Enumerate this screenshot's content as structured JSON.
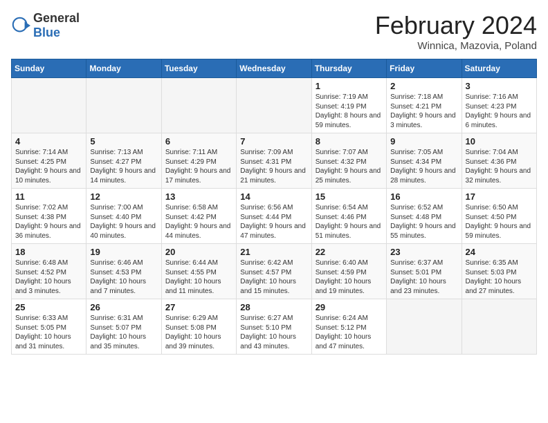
{
  "logo": {
    "general": "General",
    "blue": "Blue"
  },
  "header": {
    "title": "February 2024",
    "subtitle": "Winnica, Mazovia, Poland"
  },
  "weekdays": [
    "Sunday",
    "Monday",
    "Tuesday",
    "Wednesday",
    "Thursday",
    "Friday",
    "Saturday"
  ],
  "weeks": [
    [
      {
        "day": "",
        "info": ""
      },
      {
        "day": "",
        "info": ""
      },
      {
        "day": "",
        "info": ""
      },
      {
        "day": "",
        "info": ""
      },
      {
        "day": "1",
        "info": "Sunrise: 7:19 AM\nSunset: 4:19 PM\nDaylight: 8 hours and 59 minutes."
      },
      {
        "day": "2",
        "info": "Sunrise: 7:18 AM\nSunset: 4:21 PM\nDaylight: 9 hours and 3 minutes."
      },
      {
        "day": "3",
        "info": "Sunrise: 7:16 AM\nSunset: 4:23 PM\nDaylight: 9 hours and 6 minutes."
      }
    ],
    [
      {
        "day": "4",
        "info": "Sunrise: 7:14 AM\nSunset: 4:25 PM\nDaylight: 9 hours and 10 minutes."
      },
      {
        "day": "5",
        "info": "Sunrise: 7:13 AM\nSunset: 4:27 PM\nDaylight: 9 hours and 14 minutes."
      },
      {
        "day": "6",
        "info": "Sunrise: 7:11 AM\nSunset: 4:29 PM\nDaylight: 9 hours and 17 minutes."
      },
      {
        "day": "7",
        "info": "Sunrise: 7:09 AM\nSunset: 4:31 PM\nDaylight: 9 hours and 21 minutes."
      },
      {
        "day": "8",
        "info": "Sunrise: 7:07 AM\nSunset: 4:32 PM\nDaylight: 9 hours and 25 minutes."
      },
      {
        "day": "9",
        "info": "Sunrise: 7:05 AM\nSunset: 4:34 PM\nDaylight: 9 hours and 28 minutes."
      },
      {
        "day": "10",
        "info": "Sunrise: 7:04 AM\nSunset: 4:36 PM\nDaylight: 9 hours and 32 minutes."
      }
    ],
    [
      {
        "day": "11",
        "info": "Sunrise: 7:02 AM\nSunset: 4:38 PM\nDaylight: 9 hours and 36 minutes."
      },
      {
        "day": "12",
        "info": "Sunrise: 7:00 AM\nSunset: 4:40 PM\nDaylight: 9 hours and 40 minutes."
      },
      {
        "day": "13",
        "info": "Sunrise: 6:58 AM\nSunset: 4:42 PM\nDaylight: 9 hours and 44 minutes."
      },
      {
        "day": "14",
        "info": "Sunrise: 6:56 AM\nSunset: 4:44 PM\nDaylight: 9 hours and 47 minutes."
      },
      {
        "day": "15",
        "info": "Sunrise: 6:54 AM\nSunset: 4:46 PM\nDaylight: 9 hours and 51 minutes."
      },
      {
        "day": "16",
        "info": "Sunrise: 6:52 AM\nSunset: 4:48 PM\nDaylight: 9 hours and 55 minutes."
      },
      {
        "day": "17",
        "info": "Sunrise: 6:50 AM\nSunset: 4:50 PM\nDaylight: 9 hours and 59 minutes."
      }
    ],
    [
      {
        "day": "18",
        "info": "Sunrise: 6:48 AM\nSunset: 4:52 PM\nDaylight: 10 hours and 3 minutes."
      },
      {
        "day": "19",
        "info": "Sunrise: 6:46 AM\nSunset: 4:53 PM\nDaylight: 10 hours and 7 minutes."
      },
      {
        "day": "20",
        "info": "Sunrise: 6:44 AM\nSunset: 4:55 PM\nDaylight: 10 hours and 11 minutes."
      },
      {
        "day": "21",
        "info": "Sunrise: 6:42 AM\nSunset: 4:57 PM\nDaylight: 10 hours and 15 minutes."
      },
      {
        "day": "22",
        "info": "Sunrise: 6:40 AM\nSunset: 4:59 PM\nDaylight: 10 hours and 19 minutes."
      },
      {
        "day": "23",
        "info": "Sunrise: 6:37 AM\nSunset: 5:01 PM\nDaylight: 10 hours and 23 minutes."
      },
      {
        "day": "24",
        "info": "Sunrise: 6:35 AM\nSunset: 5:03 PM\nDaylight: 10 hours and 27 minutes."
      }
    ],
    [
      {
        "day": "25",
        "info": "Sunrise: 6:33 AM\nSunset: 5:05 PM\nDaylight: 10 hours and 31 minutes."
      },
      {
        "day": "26",
        "info": "Sunrise: 6:31 AM\nSunset: 5:07 PM\nDaylight: 10 hours and 35 minutes."
      },
      {
        "day": "27",
        "info": "Sunrise: 6:29 AM\nSunset: 5:08 PM\nDaylight: 10 hours and 39 minutes."
      },
      {
        "day": "28",
        "info": "Sunrise: 6:27 AM\nSunset: 5:10 PM\nDaylight: 10 hours and 43 minutes."
      },
      {
        "day": "29",
        "info": "Sunrise: 6:24 AM\nSunset: 5:12 PM\nDaylight: 10 hours and 47 minutes."
      },
      {
        "day": "",
        "info": ""
      },
      {
        "day": "",
        "info": ""
      }
    ]
  ]
}
